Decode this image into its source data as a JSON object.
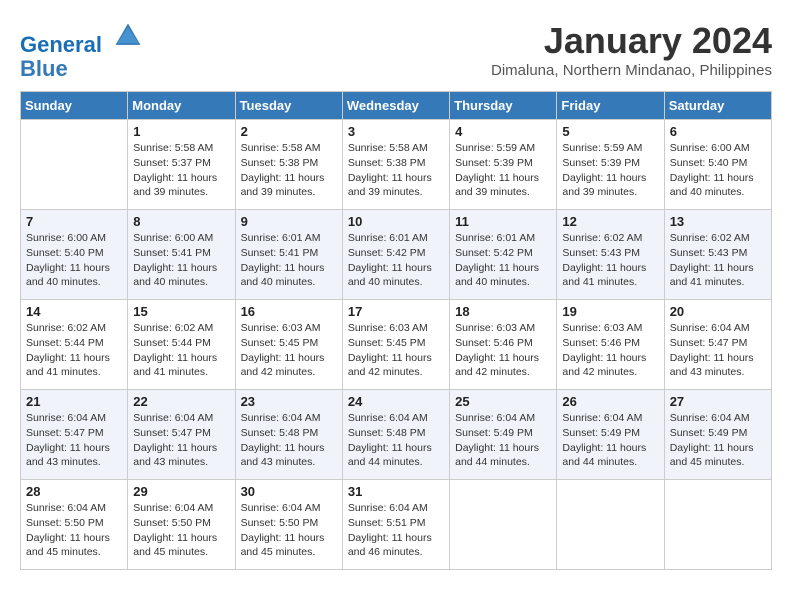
{
  "header": {
    "logo_line1": "General",
    "logo_line2": "Blue",
    "month": "January 2024",
    "location": "Dimaluna, Northern Mindanao, Philippines"
  },
  "days_of_week": [
    "Sunday",
    "Monday",
    "Tuesday",
    "Wednesday",
    "Thursday",
    "Friday",
    "Saturday"
  ],
  "weeks": [
    [
      {
        "day": "",
        "info": ""
      },
      {
        "day": "1",
        "info": "Sunrise: 5:58 AM\nSunset: 5:37 PM\nDaylight: 11 hours\nand 39 minutes."
      },
      {
        "day": "2",
        "info": "Sunrise: 5:58 AM\nSunset: 5:38 PM\nDaylight: 11 hours\nand 39 minutes."
      },
      {
        "day": "3",
        "info": "Sunrise: 5:58 AM\nSunset: 5:38 PM\nDaylight: 11 hours\nand 39 minutes."
      },
      {
        "day": "4",
        "info": "Sunrise: 5:59 AM\nSunset: 5:39 PM\nDaylight: 11 hours\nand 39 minutes."
      },
      {
        "day": "5",
        "info": "Sunrise: 5:59 AM\nSunset: 5:39 PM\nDaylight: 11 hours\nand 39 minutes."
      },
      {
        "day": "6",
        "info": "Sunrise: 6:00 AM\nSunset: 5:40 PM\nDaylight: 11 hours\nand 40 minutes."
      }
    ],
    [
      {
        "day": "7",
        "info": "Sunrise: 6:00 AM\nSunset: 5:40 PM\nDaylight: 11 hours\nand 40 minutes."
      },
      {
        "day": "8",
        "info": "Sunrise: 6:00 AM\nSunset: 5:41 PM\nDaylight: 11 hours\nand 40 minutes."
      },
      {
        "day": "9",
        "info": "Sunrise: 6:01 AM\nSunset: 5:41 PM\nDaylight: 11 hours\nand 40 minutes."
      },
      {
        "day": "10",
        "info": "Sunrise: 6:01 AM\nSunset: 5:42 PM\nDaylight: 11 hours\nand 40 minutes."
      },
      {
        "day": "11",
        "info": "Sunrise: 6:01 AM\nSunset: 5:42 PM\nDaylight: 11 hours\nand 40 minutes."
      },
      {
        "day": "12",
        "info": "Sunrise: 6:02 AM\nSunset: 5:43 PM\nDaylight: 11 hours\nand 41 minutes."
      },
      {
        "day": "13",
        "info": "Sunrise: 6:02 AM\nSunset: 5:43 PM\nDaylight: 11 hours\nand 41 minutes."
      }
    ],
    [
      {
        "day": "14",
        "info": "Sunrise: 6:02 AM\nSunset: 5:44 PM\nDaylight: 11 hours\nand 41 minutes."
      },
      {
        "day": "15",
        "info": "Sunrise: 6:02 AM\nSunset: 5:44 PM\nDaylight: 11 hours\nand 41 minutes."
      },
      {
        "day": "16",
        "info": "Sunrise: 6:03 AM\nSunset: 5:45 PM\nDaylight: 11 hours\nand 42 minutes."
      },
      {
        "day": "17",
        "info": "Sunrise: 6:03 AM\nSunset: 5:45 PM\nDaylight: 11 hours\nand 42 minutes."
      },
      {
        "day": "18",
        "info": "Sunrise: 6:03 AM\nSunset: 5:46 PM\nDaylight: 11 hours\nand 42 minutes."
      },
      {
        "day": "19",
        "info": "Sunrise: 6:03 AM\nSunset: 5:46 PM\nDaylight: 11 hours\nand 42 minutes."
      },
      {
        "day": "20",
        "info": "Sunrise: 6:04 AM\nSunset: 5:47 PM\nDaylight: 11 hours\nand 43 minutes."
      }
    ],
    [
      {
        "day": "21",
        "info": "Sunrise: 6:04 AM\nSunset: 5:47 PM\nDaylight: 11 hours\nand 43 minutes."
      },
      {
        "day": "22",
        "info": "Sunrise: 6:04 AM\nSunset: 5:47 PM\nDaylight: 11 hours\nand 43 minutes."
      },
      {
        "day": "23",
        "info": "Sunrise: 6:04 AM\nSunset: 5:48 PM\nDaylight: 11 hours\nand 43 minutes."
      },
      {
        "day": "24",
        "info": "Sunrise: 6:04 AM\nSunset: 5:48 PM\nDaylight: 11 hours\nand 44 minutes."
      },
      {
        "day": "25",
        "info": "Sunrise: 6:04 AM\nSunset: 5:49 PM\nDaylight: 11 hours\nand 44 minutes."
      },
      {
        "day": "26",
        "info": "Sunrise: 6:04 AM\nSunset: 5:49 PM\nDaylight: 11 hours\nand 44 minutes."
      },
      {
        "day": "27",
        "info": "Sunrise: 6:04 AM\nSunset: 5:49 PM\nDaylight: 11 hours\nand 45 minutes."
      }
    ],
    [
      {
        "day": "28",
        "info": "Sunrise: 6:04 AM\nSunset: 5:50 PM\nDaylight: 11 hours\nand 45 minutes."
      },
      {
        "day": "29",
        "info": "Sunrise: 6:04 AM\nSunset: 5:50 PM\nDaylight: 11 hours\nand 45 minutes."
      },
      {
        "day": "30",
        "info": "Sunrise: 6:04 AM\nSunset: 5:50 PM\nDaylight: 11 hours\nand 45 minutes."
      },
      {
        "day": "31",
        "info": "Sunrise: 6:04 AM\nSunset: 5:51 PM\nDaylight: 11 hours\nand 46 minutes."
      },
      {
        "day": "",
        "info": ""
      },
      {
        "day": "",
        "info": ""
      },
      {
        "day": "",
        "info": ""
      }
    ]
  ]
}
